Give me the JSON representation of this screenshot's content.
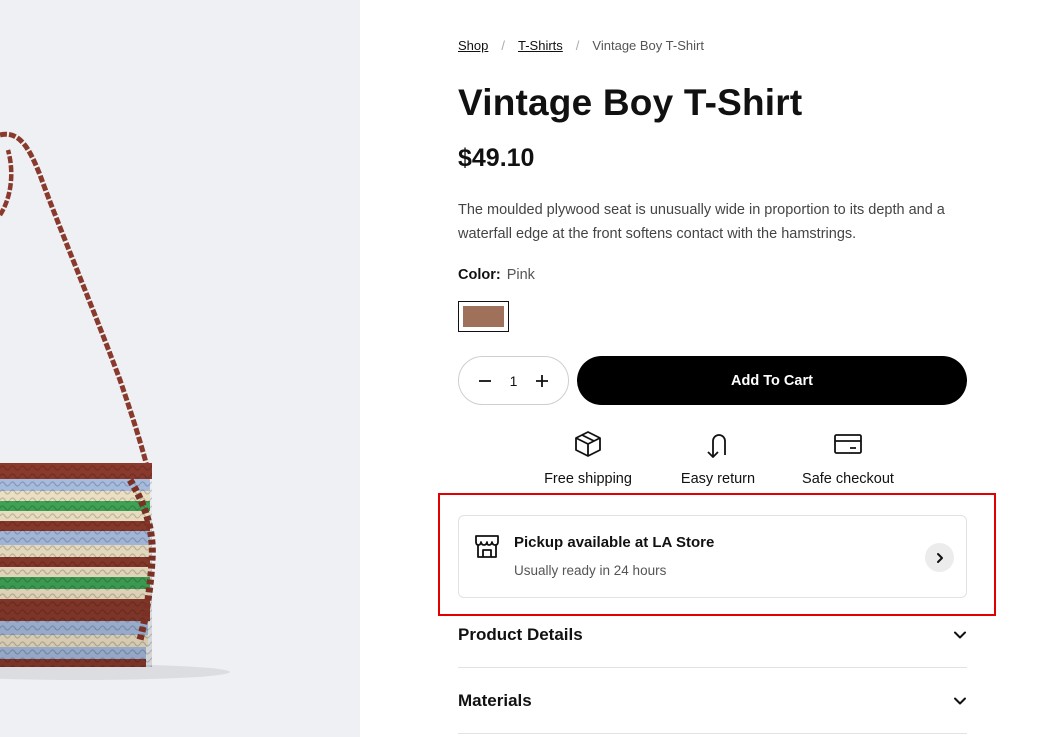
{
  "product_image": {
    "alt": "Striped woven crossbody bag",
    "colors": {
      "background": "#eef0f3",
      "strap": "#8a3a2c",
      "stripe_blue": "#a8bde0",
      "stripe_green": "#3fa556",
      "stripe_cream": "#efe3c6"
    }
  },
  "breadcrumb": {
    "items": [
      {
        "label": "Shop"
      },
      {
        "label": "T-Shirts"
      },
      {
        "label": "Vintage Boy T-Shirt"
      }
    ],
    "separator": "/"
  },
  "product": {
    "title": "Vintage Boy T-Shirt",
    "price": "$49.10",
    "description": "The moulded plywood seat is unusually wide in proportion to its depth and a waterfall edge at the front softens contact with the hamstrings."
  },
  "color": {
    "label": "Color:",
    "value": "Pink",
    "swatches": [
      {
        "hex": "#a0715a",
        "selected": true
      }
    ]
  },
  "quantity": {
    "value": "1",
    "decrement_icon": "minus-icon",
    "increment_icon": "plus-icon"
  },
  "cart": {
    "label": "Add To Cart"
  },
  "features": [
    {
      "label": "Free shipping",
      "icon": "package-icon"
    },
    {
      "label": "Easy return",
      "icon": "return-arrow-icon"
    },
    {
      "label": "Safe checkout",
      "icon": "credit-card-icon"
    }
  ],
  "pickup": {
    "title": "Pickup available at LA Store",
    "subtitle": "Usually ready in 24 hours",
    "icon": "store-icon",
    "action_icon": "chevron-right-icon"
  },
  "accordions": [
    {
      "label": "Product Details",
      "icon": "chevron-down-icon"
    },
    {
      "label": "Materials",
      "icon": "chevron-down-icon"
    }
  ],
  "highlight_color": "#e00000"
}
